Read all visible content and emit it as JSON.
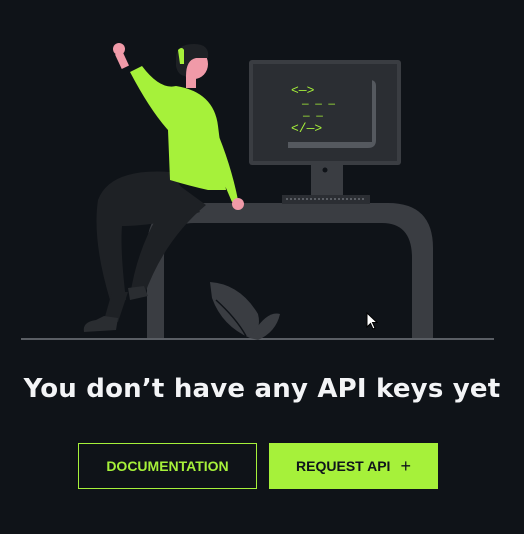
{
  "empty_state": {
    "title": "You don’t have any API keys yet"
  },
  "actions": {
    "documentation_label": "DOCUMENTATION",
    "request_api_label": "REQUEST API",
    "request_api_icon": "+"
  },
  "illustration": {
    "monitor_code_lines": [
      "<—>",
      "— —  —",
      "—  —",
      "</—>"
    ]
  },
  "colors": {
    "background": "#0f1318",
    "accent": "#a6f13a",
    "text": "#f3f4f6",
    "desk": "#3a3d42"
  }
}
